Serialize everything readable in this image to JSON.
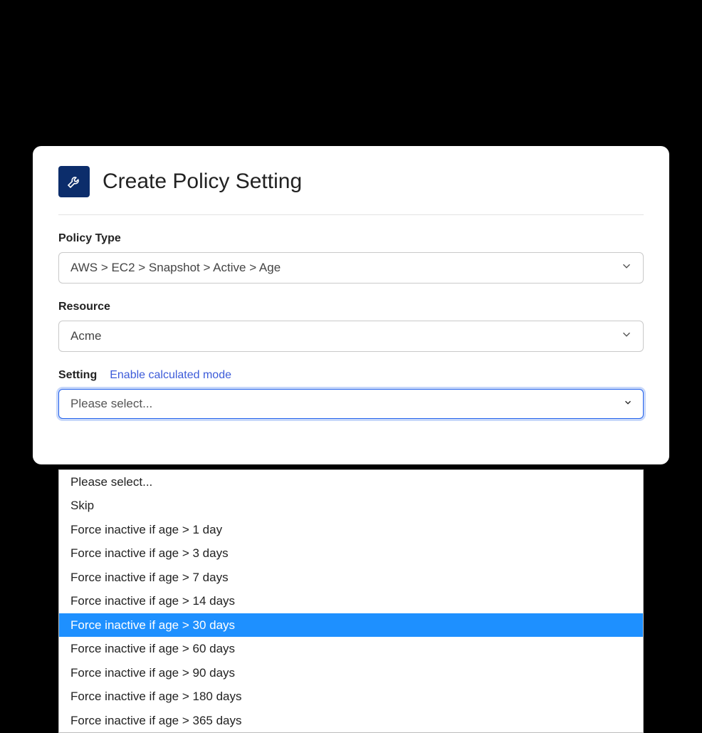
{
  "header": {
    "title": "Create Policy Setting"
  },
  "policyType": {
    "label": "Policy Type",
    "value": "AWS > EC2 > Snapshot > Active > Age"
  },
  "resource": {
    "label": "Resource",
    "value": "Acme"
  },
  "setting": {
    "label": "Setting",
    "calcLink": "Enable calculated mode",
    "value": "Please select...",
    "options": [
      "Please select...",
      "Skip",
      "Force inactive if age > 1 day",
      "Force inactive if age > 3 days",
      "Force inactive if age > 7 days",
      "Force inactive if age > 14 days",
      "Force inactive if age > 30 days",
      "Force inactive if age > 60 days",
      "Force inactive if age > 90 days",
      "Force inactive if age > 180 days",
      "Force inactive if age > 365 days"
    ],
    "highlightedIndex": 6
  }
}
